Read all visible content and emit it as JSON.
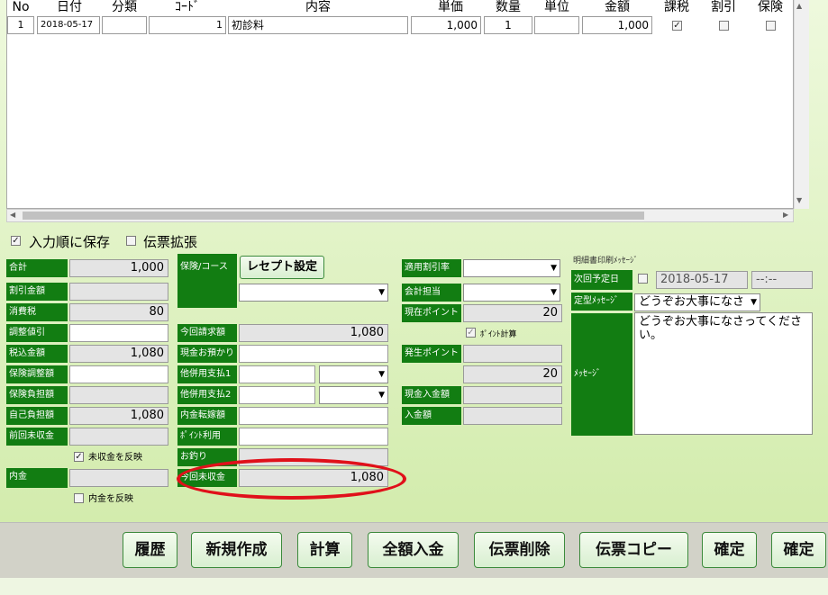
{
  "table": {
    "headers": {
      "no": "No",
      "date": "日付",
      "category": "分類",
      "code": "ｺｰﾄﾞ",
      "content": "内容",
      "unit_price": "単価",
      "quantity": "数量",
      "unit": "単位",
      "amount": "金額",
      "taxable": "課税",
      "discount": "割引",
      "insurance": "保険"
    },
    "rows": [
      {
        "no": "1",
        "date": "2018-05-17",
        "category": "",
        "code": "1",
        "content": "初診料",
        "unit_price": "1,000",
        "quantity": "1",
        "unit": "",
        "amount": "1,000",
        "taxable": true,
        "discount": false,
        "insurance": false
      }
    ]
  },
  "options": {
    "save_in_order": "入力順に保存",
    "slip_expand": "伝票拡張"
  },
  "left": {
    "total_label": "合計",
    "total": "1,000",
    "discount_amount_label": "割引金額",
    "discount_amount": "",
    "tax_label": "消費税",
    "tax": "80",
    "adjust_discount_label": "調整値引",
    "adjust_discount": "",
    "tax_included_label": "税込金額",
    "tax_included": "1,080",
    "ins_adjust_label": "保険調整額",
    "ins_adjust": "",
    "ins_burden_label": "保険負担額",
    "ins_burden": "",
    "self_burden_label": "自己負担額",
    "self_burden": "1,080",
    "prev_unpaid_label": "前回未収金",
    "prev_unpaid": "",
    "reflect_unpaid": "未収金を反映",
    "deposit_label": "内金",
    "deposit": "",
    "reflect_deposit": "内金を反映"
  },
  "middle": {
    "ins_course_label": "保険/コース",
    "receipt_button": "レセプト設定",
    "this_bill_label": "今回請求額",
    "this_bill": "1,080",
    "cash_received_label": "現金お預かり",
    "other_pay1_label": "他併用支払1",
    "other_pay2_label": "他併用支払2",
    "in_transfer_label": "内金転嫁額",
    "point_use_label": "ﾎﾟｲﾝﾄ利用",
    "change_label": "お釣り",
    "this_unpaid_label": "今回未収金",
    "this_unpaid": "1,080"
  },
  "right": {
    "discount_rate_label": "適用割引率",
    "staff_label": "会計担当",
    "current_point_label": "現在ポイント",
    "current_point": "20",
    "point_calc": "ﾎﾟｲﾝﾄ計算",
    "earned_point_label": "発生ポイント",
    "earned_point": "20",
    "cash_in_label": "現金入金額",
    "cash_in": "",
    "in_amount_label": "入金額",
    "in_amount": ""
  },
  "message": {
    "section_title": "明細書印刷ﾒｯｾｰｼﾞ",
    "next_date_label": "次回予定日",
    "next_date": "2018-05-17",
    "next_time": "--:--",
    "fixed_msg_label": "定型ﾒｯｾｰｼﾞ",
    "fixed_msg": "どうぞお大事になさ",
    "msg_label": "ﾒｯｾｰｼﾞ",
    "msg_text": "どうぞお大事になさってください。"
  },
  "buttons": {
    "history": "履歴",
    "new": "新規作成",
    "calc": "計算",
    "full_pay": "全額入金",
    "delete": "伝票削除",
    "copy": "伝票コピー",
    "confirm1": "確定",
    "confirm2": "確定"
  },
  "colors": {
    "label_green": "#127d12",
    "highlight_red": "#e0101a"
  }
}
